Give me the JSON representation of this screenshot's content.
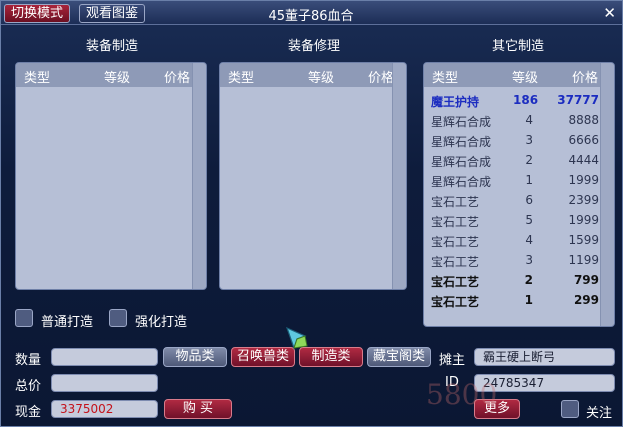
{
  "titlebar": {
    "switch_mode": "切换模式",
    "view_catalog": "观看图鉴",
    "title": "45董子86血合",
    "close": "✕"
  },
  "sections": {
    "craft": "装备制造",
    "repair": "装备修理",
    "other": "其它制造"
  },
  "table_headers": {
    "type": "类型",
    "level": "等级",
    "price": "价格"
  },
  "other_items": [
    {
      "type": "魔王护持",
      "level": "186",
      "price": "37777",
      "style": "hl"
    },
    {
      "type": "星辉石合成",
      "level": "4",
      "price": "8888",
      "style": ""
    },
    {
      "type": "星辉石合成",
      "level": "3",
      "price": "6666",
      "style": ""
    },
    {
      "type": "星辉石合成",
      "level": "2",
      "price": "4444",
      "style": ""
    },
    {
      "type": "星辉石合成",
      "level": "1",
      "price": "1999",
      "style": ""
    },
    {
      "type": "宝石工艺",
      "level": "6",
      "price": "2399",
      "style": ""
    },
    {
      "type": "宝石工艺",
      "level": "5",
      "price": "1999",
      "style": ""
    },
    {
      "type": "宝石工艺",
      "level": "4",
      "price": "1599",
      "style": ""
    },
    {
      "type": "宝石工艺",
      "level": "3",
      "price": "1199",
      "style": ""
    },
    {
      "type": "宝石工艺",
      "level": "2",
      "price": "799",
      "style": "bold"
    },
    {
      "type": "宝石工艺",
      "level": "1",
      "price": "299",
      "style": "bold"
    }
  ],
  "options": {
    "normal_forge": "普通打造",
    "enhance_forge": "强化打造"
  },
  "form": {
    "quantity_label": "数量",
    "total_label": "总价",
    "cash_label": "现金",
    "cash_value": "3375002",
    "buy": "购 买"
  },
  "categories": {
    "items": "物品类",
    "summon": "召唤兽类",
    "craft": "制造类",
    "treasure": "藏宝阁类"
  },
  "seller": {
    "seller_label": "摊主",
    "seller_name": "霸王硬上断弓",
    "id_label": "ID",
    "id_value": "24785347",
    "more": "更多",
    "follow": "关注"
  },
  "watermark": "5800"
}
